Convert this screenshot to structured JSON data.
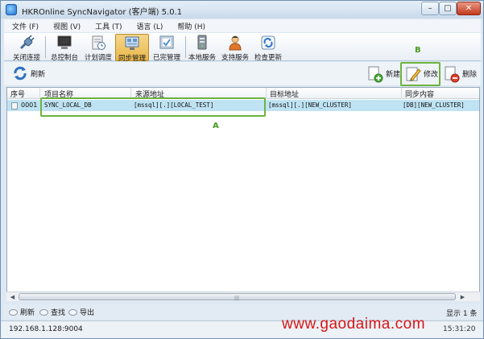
{
  "window": {
    "title": "HKROnline SyncNavigator (客户端) 5.0.1",
    "controls": {
      "minimize": "–",
      "maximize": "□",
      "close": "✕"
    }
  },
  "menu": [
    "文件 (F)",
    "视图 (V)",
    "工具 (T)",
    "语言 (L)",
    "帮助 (H)"
  ],
  "toolbar": {
    "items": [
      {
        "label": "关闭连接",
        "icon": "plug-icon"
      },
      {
        "label": "总控制台",
        "icon": "console-icon"
      },
      {
        "label": "计划调度",
        "icon": "schedule-icon"
      },
      {
        "label": "同步管理",
        "icon": "sync-manage-icon",
        "active": true
      },
      {
        "label": "已完管理",
        "icon": "completed-icon"
      },
      {
        "label": "本地服务",
        "icon": "server-icon"
      },
      {
        "label": "支持服务",
        "icon": "support-person-icon"
      },
      {
        "label": "检查更新",
        "icon": "update-icon"
      }
    ]
  },
  "actions": {
    "refresh": "刷新",
    "new": "新建",
    "edit": "修改",
    "delete": "删除"
  },
  "annotations": {
    "a": "A",
    "b": "B"
  },
  "table": {
    "columns": [
      "序号",
      "项目名称",
      "来源地址",
      "目标地址",
      "同步内容"
    ],
    "rows": [
      {
        "seq": "0001",
        "name": "SYNC_LOCAL_DB",
        "source": "[mssql][.][LOCAL_TEST]",
        "target": "[mssql][.][NEW_CLUSTER]",
        "content": "[DB][NEW_CLUSTER]"
      }
    ]
  },
  "bottom": {
    "buttons": [
      "刷新",
      "查找",
      "导出"
    ],
    "count": "显示 1 条"
  },
  "status": {
    "ip": "192.168.1.128:9004",
    "time": "15:31:20"
  },
  "watermark": "www.gaodaima.com",
  "colors": {
    "highlight": "#6cb33f",
    "selected_row": "#bfe3f3",
    "watermark": "#d61515"
  }
}
